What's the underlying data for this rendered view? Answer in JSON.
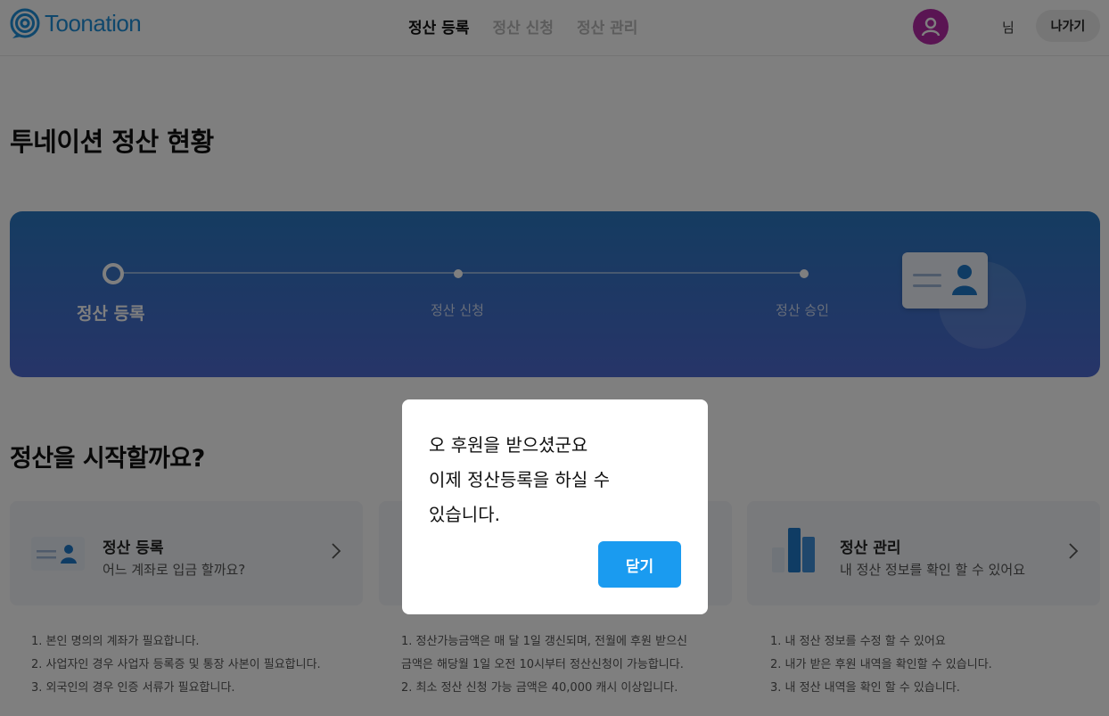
{
  "header": {
    "logo_text": "Toonation",
    "nav": [
      {
        "label": "정산 등록",
        "active": true
      },
      {
        "label": "정산 신청",
        "active": false
      },
      {
        "label": "정산 관리",
        "active": false
      }
    ],
    "user_suffix": "님",
    "exit_label": "나가기",
    "avatar_color": "#b52aa6"
  },
  "page_title": "투네이션 정산 현황",
  "progress": {
    "steps": [
      "정산 등록",
      "정산 신청",
      "정산 승인"
    ],
    "current_step": 1
  },
  "section_title": "정산을 시작할까요?",
  "cards": [
    {
      "title": "정산 등록",
      "desc": "어느 계좌로 입금 할까요?",
      "icon": "id-card-icon",
      "notes": [
        "1. 본인 명의의 계좌가 필요합니다.",
        "2. 사업자인 경우 사업자 등록증 및 통장 사본이 필요합니다.",
        "3. 외국인의 경우 인증 서류가 필요합니다."
      ]
    },
    {
      "title": "",
      "desc": "",
      "icon": "",
      "notes": [
        "1. 정산가능금액은 매 달 1일 갱신되며, 전월에 후원 받으신",
        "금액은 해당월 1일 오전 10시부터 정산신청이 가능합니다.",
        "2. 최소 정산 신청 가능 금액은 40,000 캐시 이상입니다."
      ]
    },
    {
      "title": "정산 관리",
      "desc": "내 정산 정보를 확인 할 수 있어요",
      "icon": "bar-chart-icon",
      "notes": [
        "1. 내 정산 정보를 수정 할 수 있어요",
        "2. 내가 받은 후원 내역을 확인할 수 있습니다.",
        "3. 내 정산 내역을 확인 할 수 있습니다."
      ]
    }
  ],
  "modal": {
    "message_lines": [
      "오 후원을 받으셨군요",
      "이제 정산등록을 하실 수",
      "있습니다."
    ],
    "close_label": "닫기"
  },
  "colors": {
    "accent": "#1a9bf0",
    "brand": "#1e8ed8",
    "banner_top": "#2a78c2",
    "banner_bottom": "#4e6ad1"
  }
}
